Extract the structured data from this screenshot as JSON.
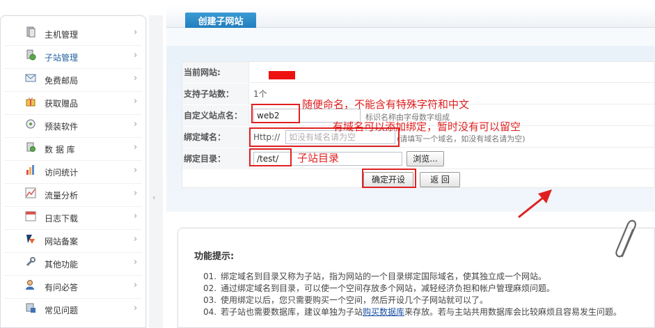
{
  "sidebar": {
    "items": [
      {
        "label": "主机管理",
        "icon": "server-icon"
      },
      {
        "label": "子站管理",
        "icon": "subsite-icon"
      },
      {
        "label": "免费邮局",
        "icon": "mail-icon"
      },
      {
        "label": "获取赠品",
        "icon": "gift-icon"
      },
      {
        "label": "预装软件",
        "icon": "software-icon"
      },
      {
        "label": "数 据 库",
        "icon": "database-icon"
      },
      {
        "label": "访问统计",
        "icon": "stats-icon"
      },
      {
        "label": "流量分析",
        "icon": "traffic-chart-icon"
      },
      {
        "label": "日志下载",
        "icon": "calendar-icon"
      },
      {
        "label": "网站备案",
        "icon": "record-icon"
      },
      {
        "label": "其他功能",
        "icon": "wrench-icon"
      },
      {
        "label": "有问必答",
        "icon": "user-help-icon"
      },
      {
        "label": "常见问题",
        "icon": "faq-icon"
      }
    ],
    "chevron": "›"
  },
  "tab": {
    "title": "创建子网站"
  },
  "form": {
    "current_site_label": "当前网站:",
    "support_count_label": "支持子站数：",
    "support_count_value": "1个",
    "custom_name_label": "自定义站点名：",
    "custom_name_value": "web2",
    "custom_name_hint": "标识名称由字母数字组成",
    "domain_label": "绑定域名：",
    "domain_prefix": "Http://",
    "domain_placeholder": "如没有域名请为空",
    "domain_hint": "(请填写一个域名，如没有域名请为空)",
    "dir_label": "绑定目录：",
    "dir_value": "/test/",
    "browse_label": "浏览...",
    "submit_label": "确定开设",
    "back_label": "返 回"
  },
  "annotations": {
    "note_name": "随便命名，不能含有特殊字符和中文",
    "note_domain": "有域名可以添加绑定，暂时没有可以留空",
    "note_dir": "子站目录"
  },
  "tips": {
    "title": "功能提示:",
    "lines": [
      {
        "num": "01.",
        "text": "绑定域名到目录又称为子站，指为网站的一个目录绑定国际域名，使其独立成一个网站。"
      },
      {
        "num": "02.",
        "text": "通过绑定域名到目录，可以使一个空间存放多个网站，减轻经济负担和帐户管理麻烦问题。"
      },
      {
        "num": "03.",
        "text": "使用绑定以后，您只需要购买一个空间，然后开设几个子网站就可以了。"
      },
      {
        "num": "04.",
        "text_before": "若子站也需要数据库，建议单独为子站",
        "link": "购买数据库",
        "text_after": "来存放。若与主站共用数据库会比较麻烦且容易发生问题。"
      }
    ]
  },
  "colors": {
    "tab": "#1c77b8",
    "annotation": "#e02020",
    "link": "#1a4fa3"
  }
}
